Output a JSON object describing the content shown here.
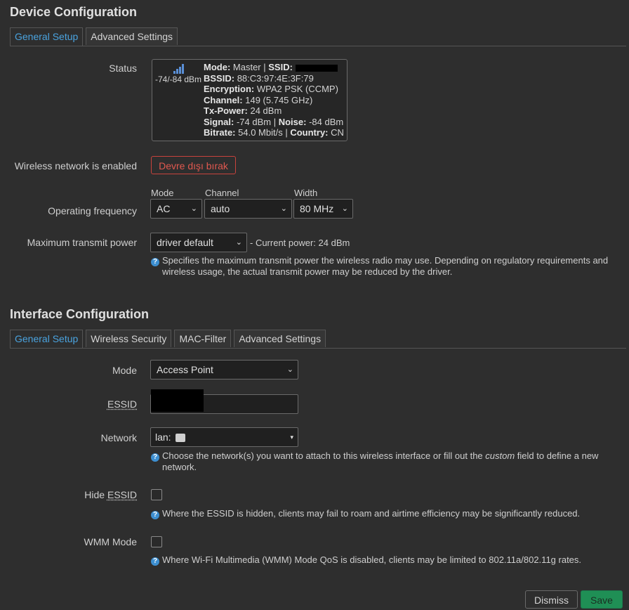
{
  "device": {
    "title": "Device Configuration",
    "tabs": [
      "General Setup",
      "Advanced Settings"
    ],
    "status_label": "Status",
    "status": {
      "signal_dbm": "-74/-84 dBm",
      "mode_key": "Mode:",
      "mode_val": "Master",
      "ssid_key": "SSID:",
      "bssid_key": "BSSID:",
      "bssid_val": "88:C3:97:4E:3F:79",
      "enc_key": "Encryption:",
      "enc_val": "WPA2 PSK (CCMP)",
      "chan_key": "Channel:",
      "chan_val": "149 (5.745 GHz)",
      "tx_key": "Tx-Power:",
      "tx_val": "24 dBm",
      "sig_key": "Signal:",
      "sig_val": "-74 dBm",
      "noise_key": "Noise:",
      "noise_val": "-84 dBm",
      "bitrate_key": "Bitrate:",
      "bitrate_val": "54.0 Mbit/s",
      "country_key": "Country:",
      "country_val": "CN"
    },
    "wireless_label": "Wireless network is enabled",
    "disable_button": "Devre dışı bırak",
    "freq_label": "Operating frequency",
    "mode_sub": "Mode",
    "channel_sub": "Channel",
    "width_sub": "Width",
    "mode_value": "AC",
    "channel_value": "auto",
    "width_value": "80 MHz",
    "txpower_label": "Maximum transmit power",
    "txpower_value": "driver default",
    "current_power": "- Current power: 24 dBm",
    "txpower_help_1": "Specifies the maximum transmit power the wireless radio may use. Depending on regulatory requirements and",
    "txpower_help_2": "wireless usage, the actual transmit power may be reduced by the driver."
  },
  "iface": {
    "title": "Interface Configuration",
    "tabs": [
      "General Setup",
      "Wireless Security",
      "MAC-Filter",
      "Advanced Settings"
    ],
    "mode_label": "Mode",
    "mode_value": "Access Point",
    "essid_label": "ESSID",
    "network_label": "Network",
    "network_value": "lan:",
    "network_help_1a": "Choose the network(s) you want to attach to this wireless interface or fill out the ",
    "network_help_custom": "custom",
    "network_help_1b": " field to define a new",
    "network_help_2": "network.",
    "hide_label_pre": "Hide ",
    "hide_label_abbr": "ESSID",
    "hide_help": "Where the ESSID is hidden, clients may fail to roam and airtime efficiency may be significantly reduced.",
    "wmm_label": "WMM Mode",
    "wmm_help": "Where Wi-Fi Multimedia (WMM) Mode QoS is disabled, clients may be limited to 802.11a/802.11g rates."
  },
  "footer": {
    "dismiss": "Dismiss",
    "save": "Save"
  },
  "icons": {
    "signal": "signal-bars-icon",
    "help": "help-circle-icon",
    "chevron": "chevron-down-icon",
    "network": "network-ports-icon"
  },
  "colors": {
    "accent": "#4aa3df",
    "danger": "#e0584f",
    "save": "#1f8f55"
  }
}
